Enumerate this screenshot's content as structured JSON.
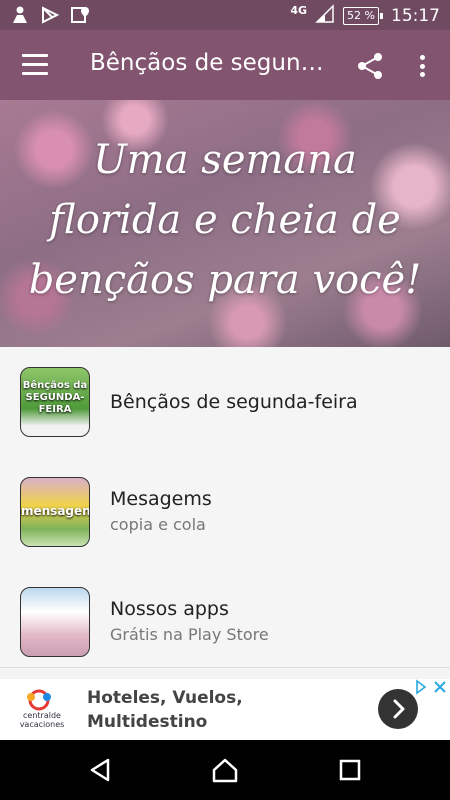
{
  "status_bar": {
    "network": "4G",
    "battery": "52 %",
    "time": "15:17"
  },
  "app_bar": {
    "title": "Bênçãos de segunda-feira"
  },
  "banner": {
    "line1": "Uma semana",
    "line2": "florida e cheia de",
    "line3": "bençãos para você!"
  },
  "list": {
    "items": [
      {
        "title": "Bênçãos de segunda-feira",
        "subtitle": "",
        "thumb_caption": "Bênçãos da SEGUNDA-FEIRA"
      },
      {
        "title": "Mesagems",
        "subtitle": "copia e cola",
        "thumb_caption": "mensagens"
      },
      {
        "title": "Nossos apps",
        "subtitle": "Grátis na Play Store",
        "thumb_caption": ""
      }
    ]
  },
  "ad": {
    "brand_line1": "centraldе",
    "brand_line2": "vacaciones",
    "headline": "Hoteles, Vuelos, Multidestino"
  },
  "colors": {
    "status_bar": "#6f4a61",
    "app_bar": "#83546f",
    "ad_button": "#333333"
  }
}
